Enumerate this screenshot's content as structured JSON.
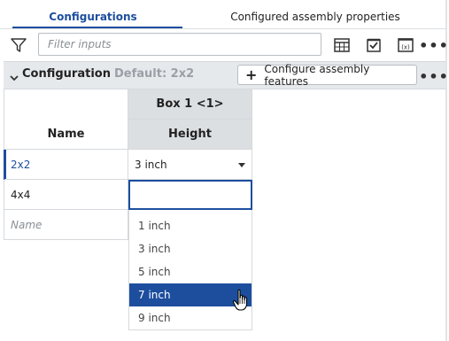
{
  "tabs": [
    {
      "label": "Configurations",
      "active": true
    },
    {
      "label": "Configured assembly properties",
      "active": false
    }
  ],
  "toolbar": {
    "filter_placeholder": "Filter inputs",
    "icons": [
      "filter-icon",
      "table-icon",
      "checkbox-icon",
      "variable-icon",
      "more-icon"
    ]
  },
  "section": {
    "title": "Configuration",
    "default_label": "Default: 2x2",
    "configure_button": "Configure assembly features"
  },
  "table": {
    "name_header": "Name",
    "part_header": "Box 1 <1>",
    "param_header": "Height",
    "rows": [
      {
        "name": "2x2",
        "value": "3 inch",
        "active": true
      },
      {
        "name": "4x4",
        "value": "",
        "editing": true
      },
      {
        "name": "Name",
        "placeholder": true
      }
    ]
  },
  "dropdown": {
    "options": [
      "1 inch",
      "3 inch",
      "5 inch",
      "7 inch",
      "9 inch"
    ],
    "highlighted": "7 inch"
  },
  "colors": {
    "accent": "#1d4e9e",
    "header_bg": "#dcdfe2",
    "section_bg": "#e6e9ec"
  }
}
